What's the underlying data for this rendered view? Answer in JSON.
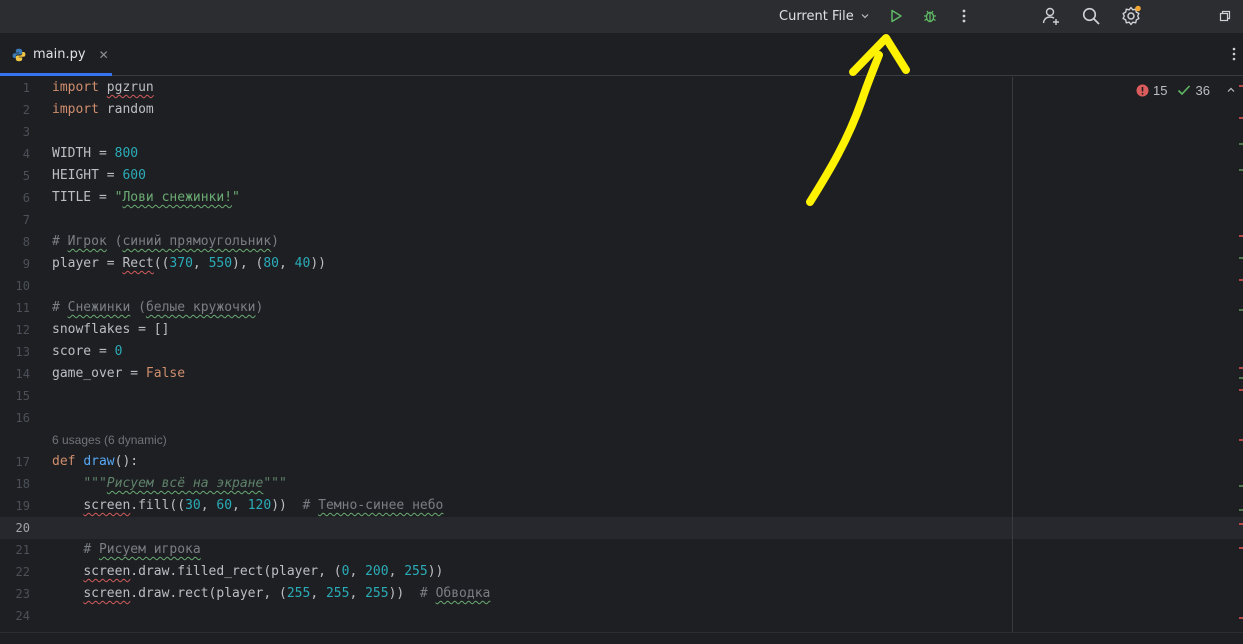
{
  "toolbar": {
    "run_config_label": "Current File",
    "icons": [
      "chevron-down-icon",
      "run-icon",
      "debug-icon",
      "more-vert-icon",
      "add-user-icon",
      "search-icon",
      "settings-icon",
      "restore-window-icon"
    ]
  },
  "tabs": [
    {
      "label": "main.py",
      "icon": "python-file-icon",
      "active": true
    }
  ],
  "inspections": {
    "errors": "15",
    "ok": "36"
  },
  "editor": {
    "lines": [
      {
        "n": "1"
      },
      {
        "n": "2"
      },
      {
        "n": "3"
      },
      {
        "n": "4"
      },
      {
        "n": "5"
      },
      {
        "n": "6"
      },
      {
        "n": "7"
      },
      {
        "n": "8"
      },
      {
        "n": "9"
      },
      {
        "n": "10"
      },
      {
        "n": "11"
      },
      {
        "n": "12"
      },
      {
        "n": "13"
      },
      {
        "n": "14"
      },
      {
        "n": "15"
      },
      {
        "n": "16"
      },
      {
        "n": "17"
      },
      {
        "n": "18"
      },
      {
        "n": "19"
      },
      {
        "n": "20"
      },
      {
        "n": "21"
      },
      {
        "n": "22"
      },
      {
        "n": "23"
      },
      {
        "n": "24"
      }
    ],
    "usage_hint": "6 usages (6 dynamic)",
    "code": {
      "l1_kw": "import",
      "l1_mod": "pgzrun",
      "l2_kw": "import",
      "l2_mod": " random",
      "l4_name": "WIDTH = ",
      "l4_num": "800",
      "l5_name": "HEIGHT = ",
      "l5_num": "600",
      "l6_name": "TITLE = ",
      "l6_q1": "\"",
      "l6_str": "Лови снежинки!",
      "l6_q2": "\"",
      "l8_c1": "# ",
      "l8_w1": "Игрок",
      "l8_c2": " (",
      "l8_w2": "синий прямоугольник",
      "l8_c3": ")",
      "l9_a": "player = ",
      "l9_fn": "Rect",
      "l9_b": "((",
      "l9_n1": "370",
      "l9_c": ", ",
      "l9_n2": "550",
      "l9_d": "), (",
      "l9_n3": "80",
      "l9_e": ", ",
      "l9_n4": "40",
      "l9_f": "))",
      "l11_c1": "# ",
      "l11_w1": "Снежинки",
      "l11_c2": " (",
      "l11_w2": "белые кружочки",
      "l11_c3": ")",
      "l12": "snowflakes = []",
      "l13_a": "score = ",
      "l13_n": "0",
      "l14_a": "game_over = ",
      "l14_kw": "False",
      "l17_kw": "def ",
      "l17_fn": "draw",
      "l17_b": "():",
      "l18_q": "\"\"\"",
      "l18_w": "Рисуем всё на экране",
      "l18_q2": "\"\"\"",
      "l19_obj": "screen",
      "l19_a": ".fill((",
      "l19_n1": "30",
      "l19_b": ", ",
      "l19_n2": "60",
      "l19_c": ", ",
      "l19_n3": "120",
      "l19_d": "))  ",
      "l19_c1": "# ",
      "l19_w": "Темно-синее небо",
      "l21_c1": "# ",
      "l21_w": "Рисуем игрока",
      "l22_obj": "screen",
      "l22_a": ".draw.filled_rect(player, (",
      "l22_n1": "0",
      "l22_b": ", ",
      "l22_n2": "200",
      "l22_c": ", ",
      "l22_n3": "255",
      "l22_d": "))",
      "l23_obj": "screen",
      "l23_a": ".draw.rect(player, (",
      "l23_n1": "255",
      "l23_b": ", ",
      "l23_n2": "255",
      "l23_c": ", ",
      "l23_n3": "255",
      "l23_d": "))  ",
      "l23_c1": "# ",
      "l23_w": "Обводка"
    }
  },
  "colors": {
    "background": "#1e1f22",
    "keyword": "#cf8e6d",
    "number": "#2aacb8",
    "string": "#6aab73",
    "function": "#56a8f5",
    "accent": "#3574f0",
    "annotation_arrow": "#fff200"
  }
}
